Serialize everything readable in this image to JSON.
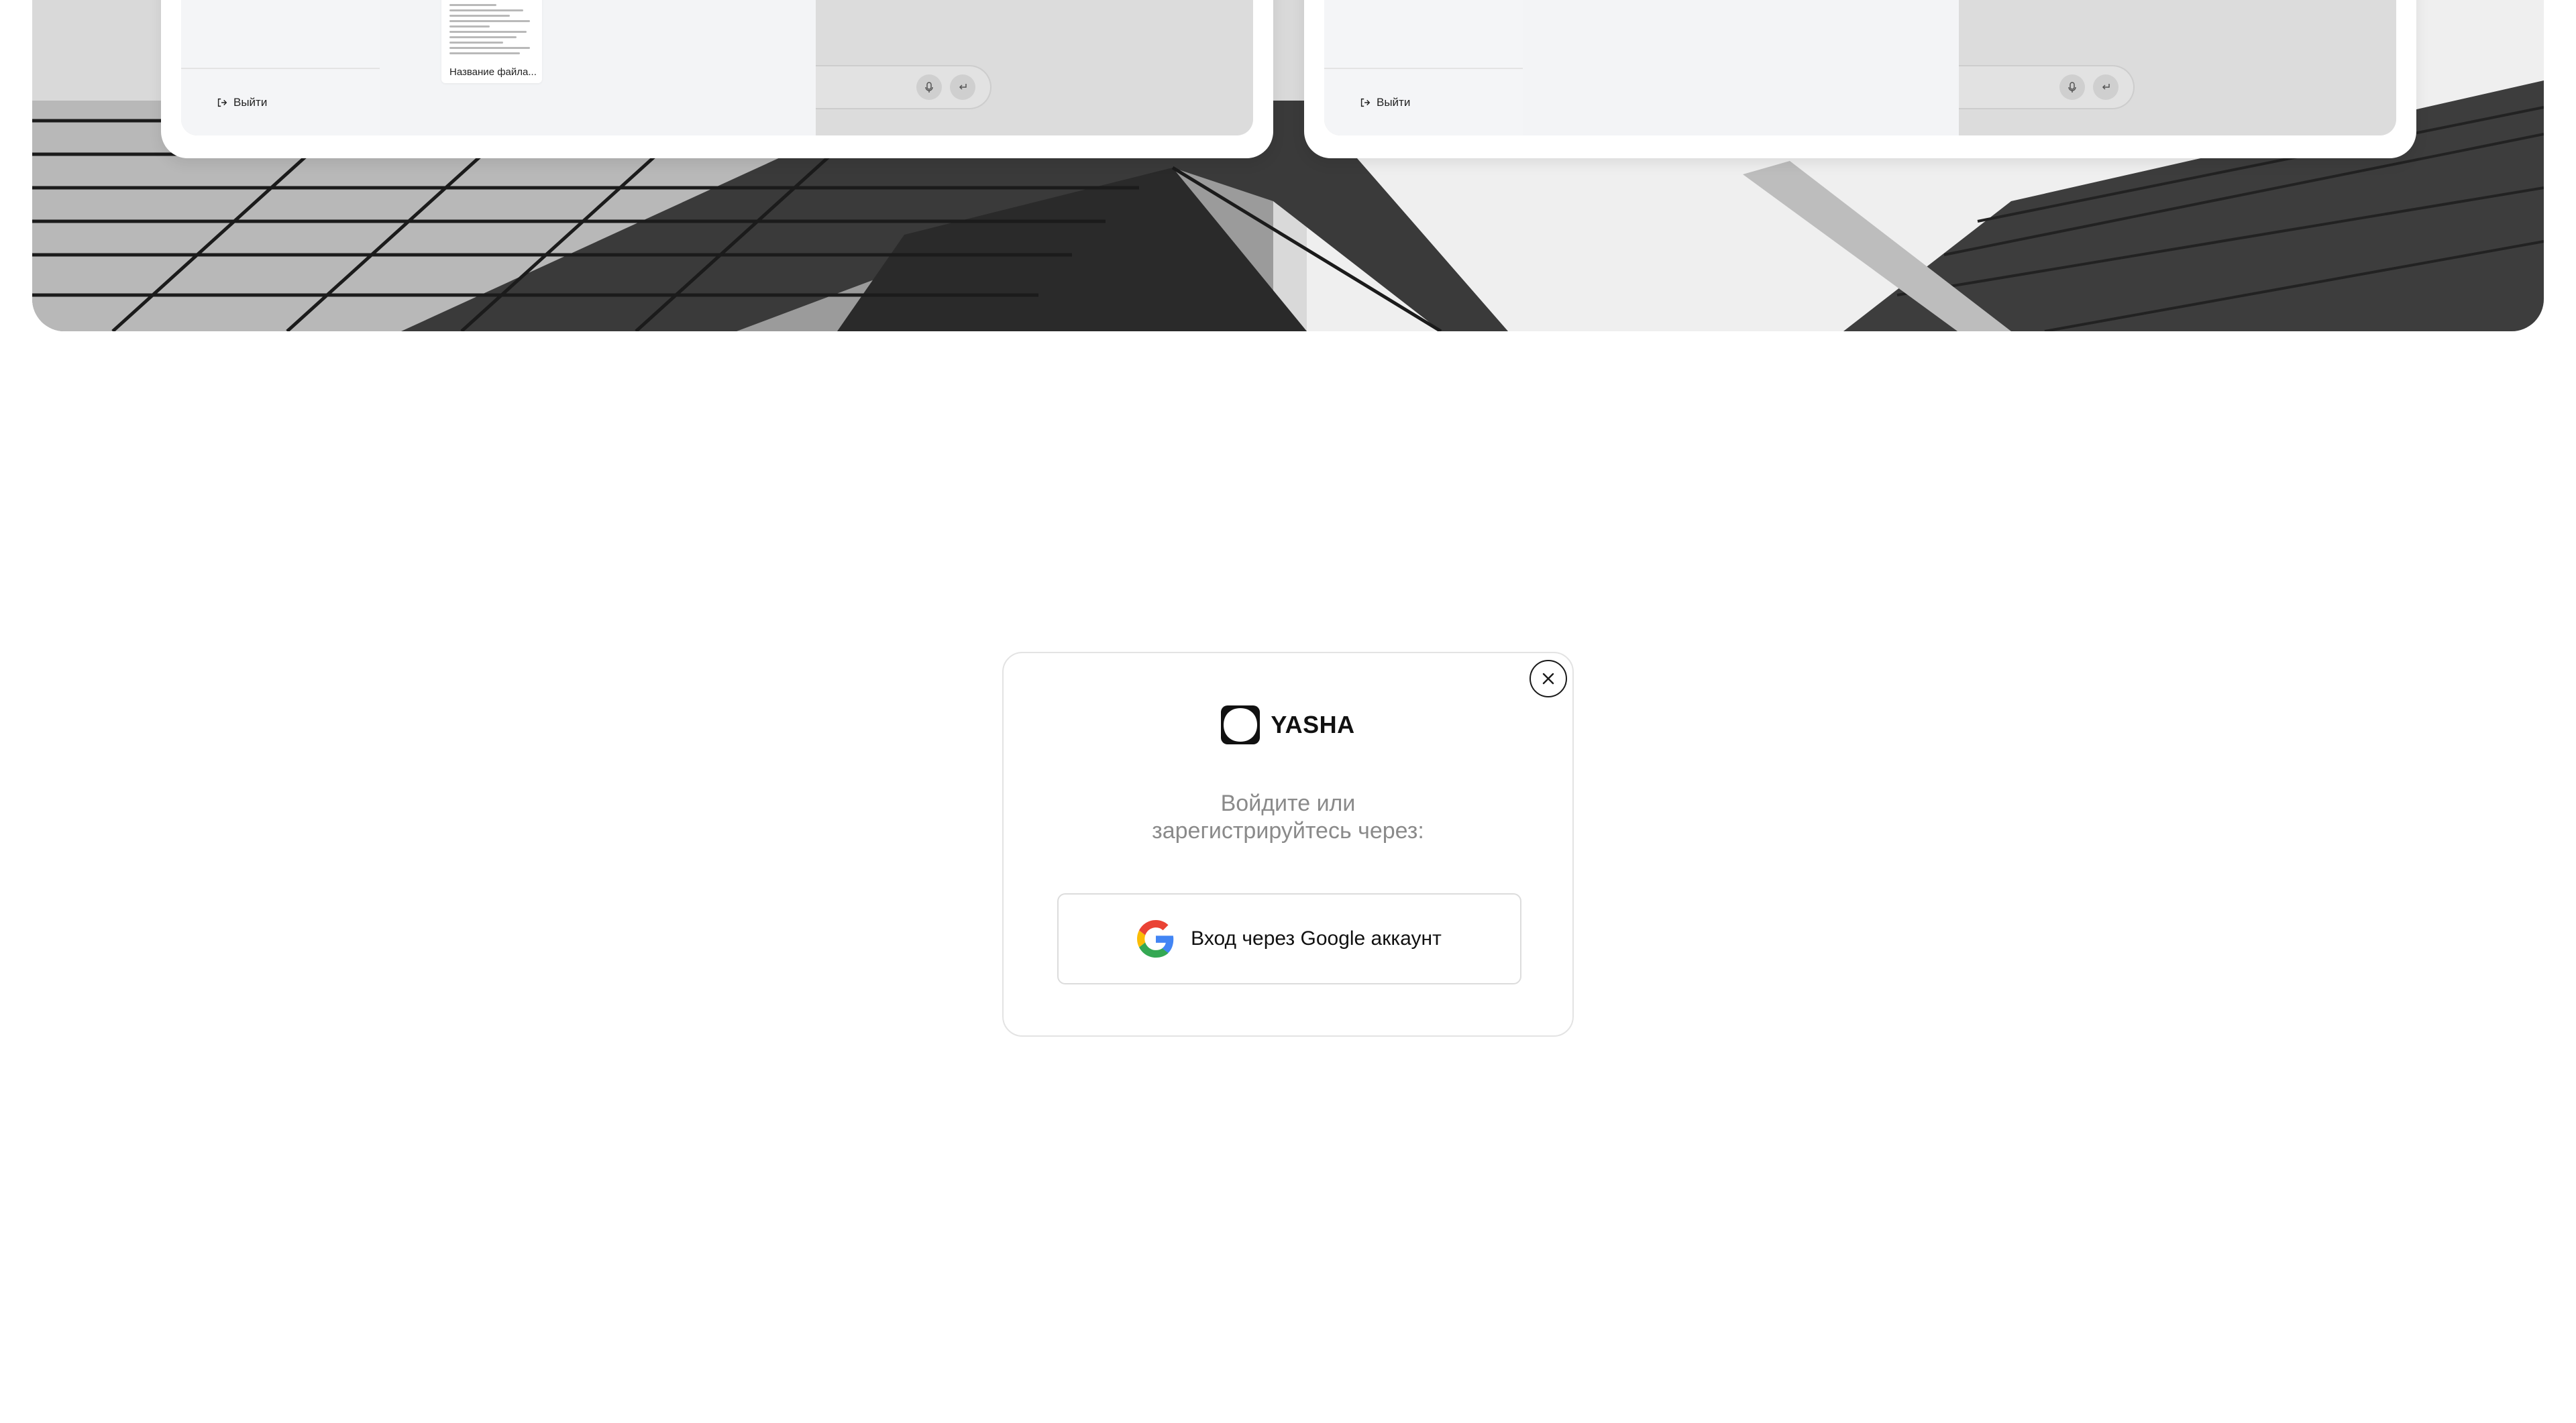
{
  "previews": {
    "left": {
      "logout_label": "Выйти",
      "file_caption": "Название файла..."
    },
    "right": {
      "logout_label": "Выйти"
    }
  },
  "login_modal": {
    "brand_name": "YASHA",
    "prompt_line1": "Войдите или",
    "prompt_line2": "зарегистрируйтесь через:",
    "google_button_label": "Вход через Google аккаунт",
    "close_icon": "close-icon"
  },
  "colors": {
    "google_blue": "#4285F4",
    "google_red": "#EA4335",
    "google_yellow": "#FBBC05",
    "google_green": "#34A853",
    "prompt_gray": "#8a8a8a"
  }
}
